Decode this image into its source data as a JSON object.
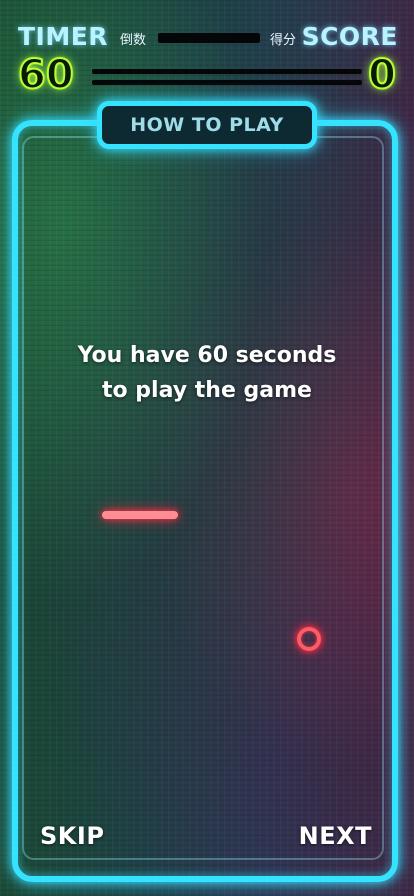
{
  "hud": {
    "timer_label": "TIMER",
    "timer_sub": "倒数",
    "timer_value": "60",
    "score_label": "SCORE",
    "score_sub": "得分",
    "score_value": "0"
  },
  "panel": {
    "title": "HOW TO PLAY",
    "instruction": "You have  60 seconds\nto play the game"
  },
  "nav": {
    "skip_label": "SKIP",
    "next_label": "NEXT"
  },
  "colors": {
    "frame_neon": "#36e3ff",
    "score_neon": "#b5ff33",
    "object_neon": "#ff2d44"
  }
}
